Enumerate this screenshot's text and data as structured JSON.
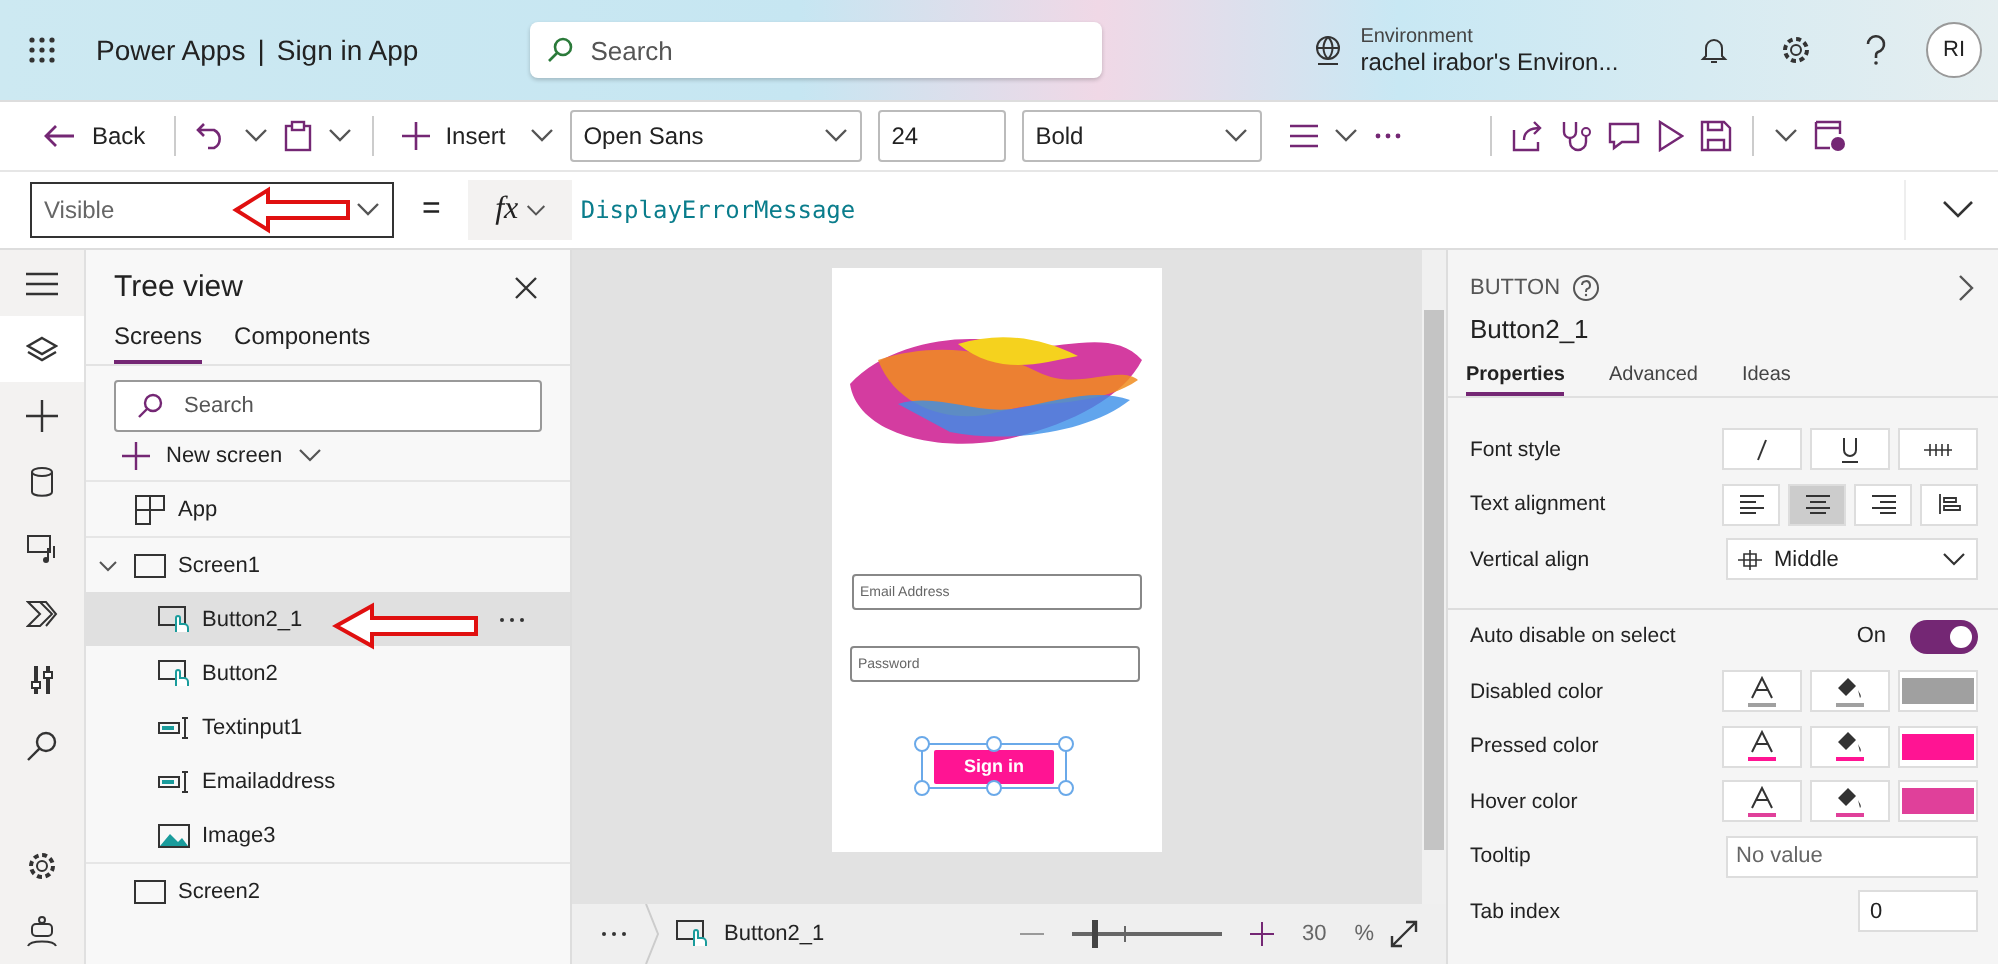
{
  "header": {
    "product": "Power Apps",
    "separator": "|",
    "app_name": "Sign in App",
    "search_placeholder": "Search",
    "environment_label": "Environment",
    "environment_name": "rachel irabor's Environ...",
    "avatar_initials": "RI"
  },
  "toolbar": {
    "back": "Back",
    "insert": "Insert",
    "font": "Open Sans",
    "font_size": "24",
    "font_weight": "Bold"
  },
  "formula_bar": {
    "property": "Visible",
    "equals": "=",
    "fx": "fx",
    "formula": "DisplayErrorMessage"
  },
  "rail": [
    {
      "kind": "menu",
      "selected": false
    },
    {
      "kind": "layers",
      "selected": true
    },
    {
      "kind": "plus",
      "selected": false
    },
    {
      "kind": "data",
      "selected": false
    },
    {
      "kind": "media",
      "selected": false
    },
    {
      "kind": "flow",
      "selected": false
    },
    {
      "kind": "tools",
      "selected": false
    },
    {
      "kind": "search",
      "selected": false
    },
    {
      "kind": "settings",
      "selected": false
    },
    {
      "kind": "bot",
      "selected": false
    }
  ],
  "tree": {
    "title": "Tree view",
    "tabs": [
      {
        "label": "Screens",
        "selected": true
      },
      {
        "label": "Components",
        "selected": false
      }
    ],
    "search_placeholder": "Search",
    "new_screen": "New screen",
    "nodes": [
      {
        "label": "App",
        "kind": "app",
        "expanded": false,
        "selected": false
      },
      {
        "label": "Screen1",
        "kind": "screen",
        "expanded": true,
        "selected": false,
        "children": [
          {
            "label": "Button2_1",
            "kind": "button",
            "selected": true
          },
          {
            "label": "Button2",
            "kind": "button",
            "selected": false
          },
          {
            "label": "Textinput1",
            "kind": "input",
            "selected": false
          },
          {
            "label": "Emailaddress",
            "kind": "input",
            "selected": false
          },
          {
            "label": "Image3",
            "kind": "image",
            "selected": false
          }
        ]
      },
      {
        "label": "Screen2",
        "kind": "screen",
        "expanded": false,
        "selected": false
      }
    ]
  },
  "canvas": {
    "email_placeholder": "Email Address",
    "password_placeholder": "Password",
    "sign_in": "Sign in",
    "selected_control": "Button2_1",
    "zoom_slider": {
      "level": 0.13
    },
    "zoom": "30",
    "percent": "%"
  },
  "properties": {
    "type": "BUTTON",
    "name": "Button2_1",
    "tabs": [
      {
        "label": "Properties",
        "selected": true
      },
      {
        "label": "Advanced",
        "selected": false
      },
      {
        "label": "Ideas",
        "selected": false
      }
    ],
    "rows": [
      {
        "kind": "font_style",
        "label": "Font style"
      },
      {
        "kind": "align",
        "label": "Text alignment",
        "options": [
          {
            "kind": "left",
            "selected": false
          },
          {
            "kind": "center",
            "selected": true
          },
          {
            "kind": "right",
            "selected": false
          },
          {
            "kind": "justify",
            "selected": false
          }
        ]
      },
      {
        "kind": "dropdown",
        "label": "Vertical align",
        "value": "Middle"
      },
      {
        "kind": "toggle",
        "label": "Auto disable on select",
        "state_text": "On",
        "on": true
      },
      {
        "kind": "colors",
        "label": "Disabled color",
        "color": "#a0a0a0"
      },
      {
        "kind": "colors",
        "label": "Pressed color",
        "color": "#ff1493"
      },
      {
        "kind": "colors",
        "label": "Hover color",
        "color": "#e0409a"
      },
      {
        "kind": "text",
        "label": "Tooltip",
        "placeholder": "No value"
      },
      {
        "kind": "number",
        "label": "Tab index",
        "value": "0"
      }
    ]
  }
}
